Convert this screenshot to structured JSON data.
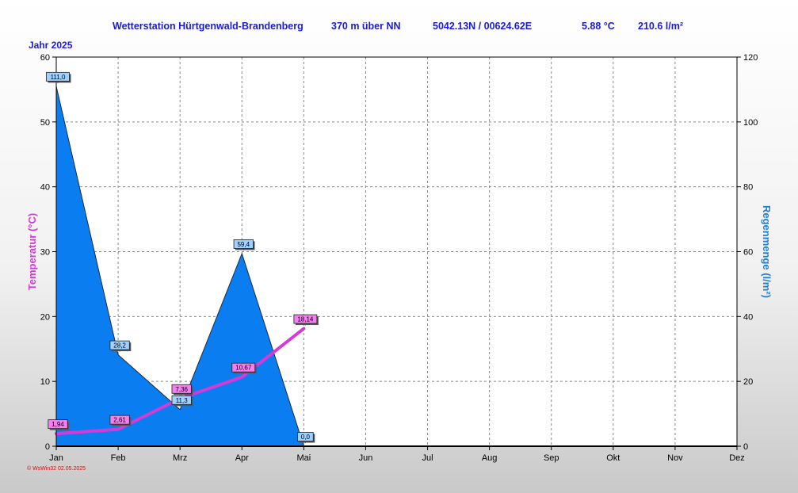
{
  "header": {
    "station": "Wetterstation Hürtgenwald-Brandenberg",
    "altitude": "370 m über NN",
    "coords": "5042.13N / 00624.62E",
    "temp": "5.88 °C",
    "rain": "210.6 l/m²"
  },
  "year_label": "Jahr  2025",
  "footer": "© WsWin32  02.05.2025",
  "colors": {
    "rain_fill": "#0a7ef0",
    "temp_line": "#d43ad6",
    "title": "#1a1adf",
    "rain_axis": "#1a80e0"
  },
  "chart_data": {
    "type": "area",
    "categories": [
      "Jan",
      "Feb",
      "Mrz",
      "Apr",
      "Mai",
      "Jun",
      "Jul",
      "Aug",
      "Sep",
      "Okt",
      "Nov",
      "Dez"
    ],
    "y_left": {
      "label": "Temperatur  (°C)",
      "lim": [
        0,
        60
      ],
      "ticks": [
        0,
        10,
        20,
        30,
        40,
        50,
        60
      ]
    },
    "y_right": {
      "label": "Regenmenge  (l/m²)",
      "lim": [
        0,
        120
      ],
      "ticks": [
        0,
        20,
        40,
        60,
        80,
        100,
        120
      ]
    },
    "grid": true,
    "series": [
      {
        "kind": "rain-area",
        "axis": "right",
        "values": [
          111.0,
          28.2,
          11.3,
          59.4,
          0.0
        ],
        "labels": [
          "111,0",
          "28,2",
          "11,3",
          "59,4",
          "0,0"
        ]
      },
      {
        "kind": "temperature-line",
        "axis": "left",
        "values": [
          1.94,
          2.61,
          7.36,
          10.67,
          18.14
        ],
        "labels": [
          "1,94",
          "2,61",
          "7,36",
          "10,67",
          "18,14"
        ]
      }
    ]
  }
}
